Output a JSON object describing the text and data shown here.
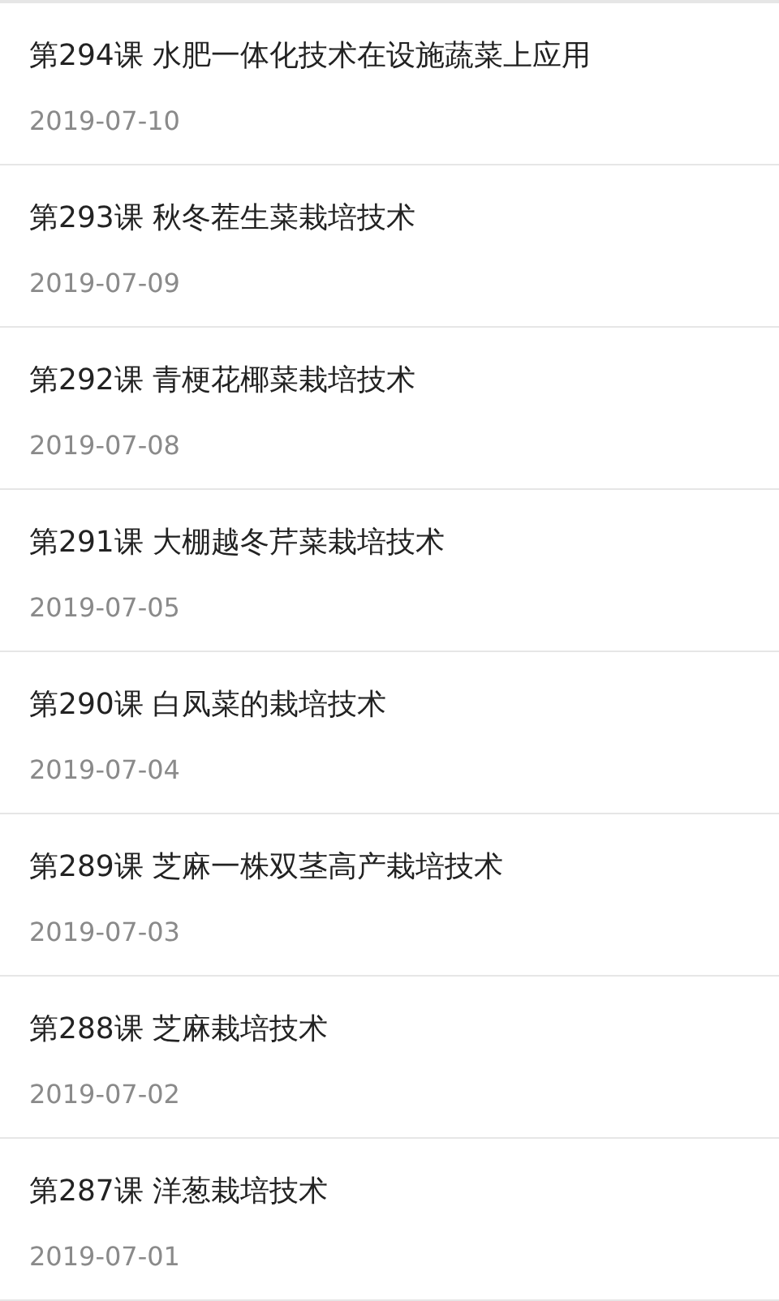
{
  "lessons": [
    {
      "title": "第294课 水肥一体化技术在设施蔬菜上应用",
      "date": "2019-07-10"
    },
    {
      "title": "第293课 秋冬茬生菜栽培技术",
      "date": "2019-07-09"
    },
    {
      "title": "第292课 青梗花椰菜栽培技术",
      "date": "2019-07-08"
    },
    {
      "title": "第291课 大棚越冬芹菜栽培技术",
      "date": "2019-07-05"
    },
    {
      "title": "第290课 白凤菜的栽培技术",
      "date": "2019-07-04"
    },
    {
      "title": "第289课 芝麻一株双茎高产栽培技术",
      "date": "2019-07-03"
    },
    {
      "title": "第288课 芝麻栽培技术",
      "date": "2019-07-02"
    },
    {
      "title": "第287课 洋葱栽培技术",
      "date": "2019-07-01"
    }
  ]
}
